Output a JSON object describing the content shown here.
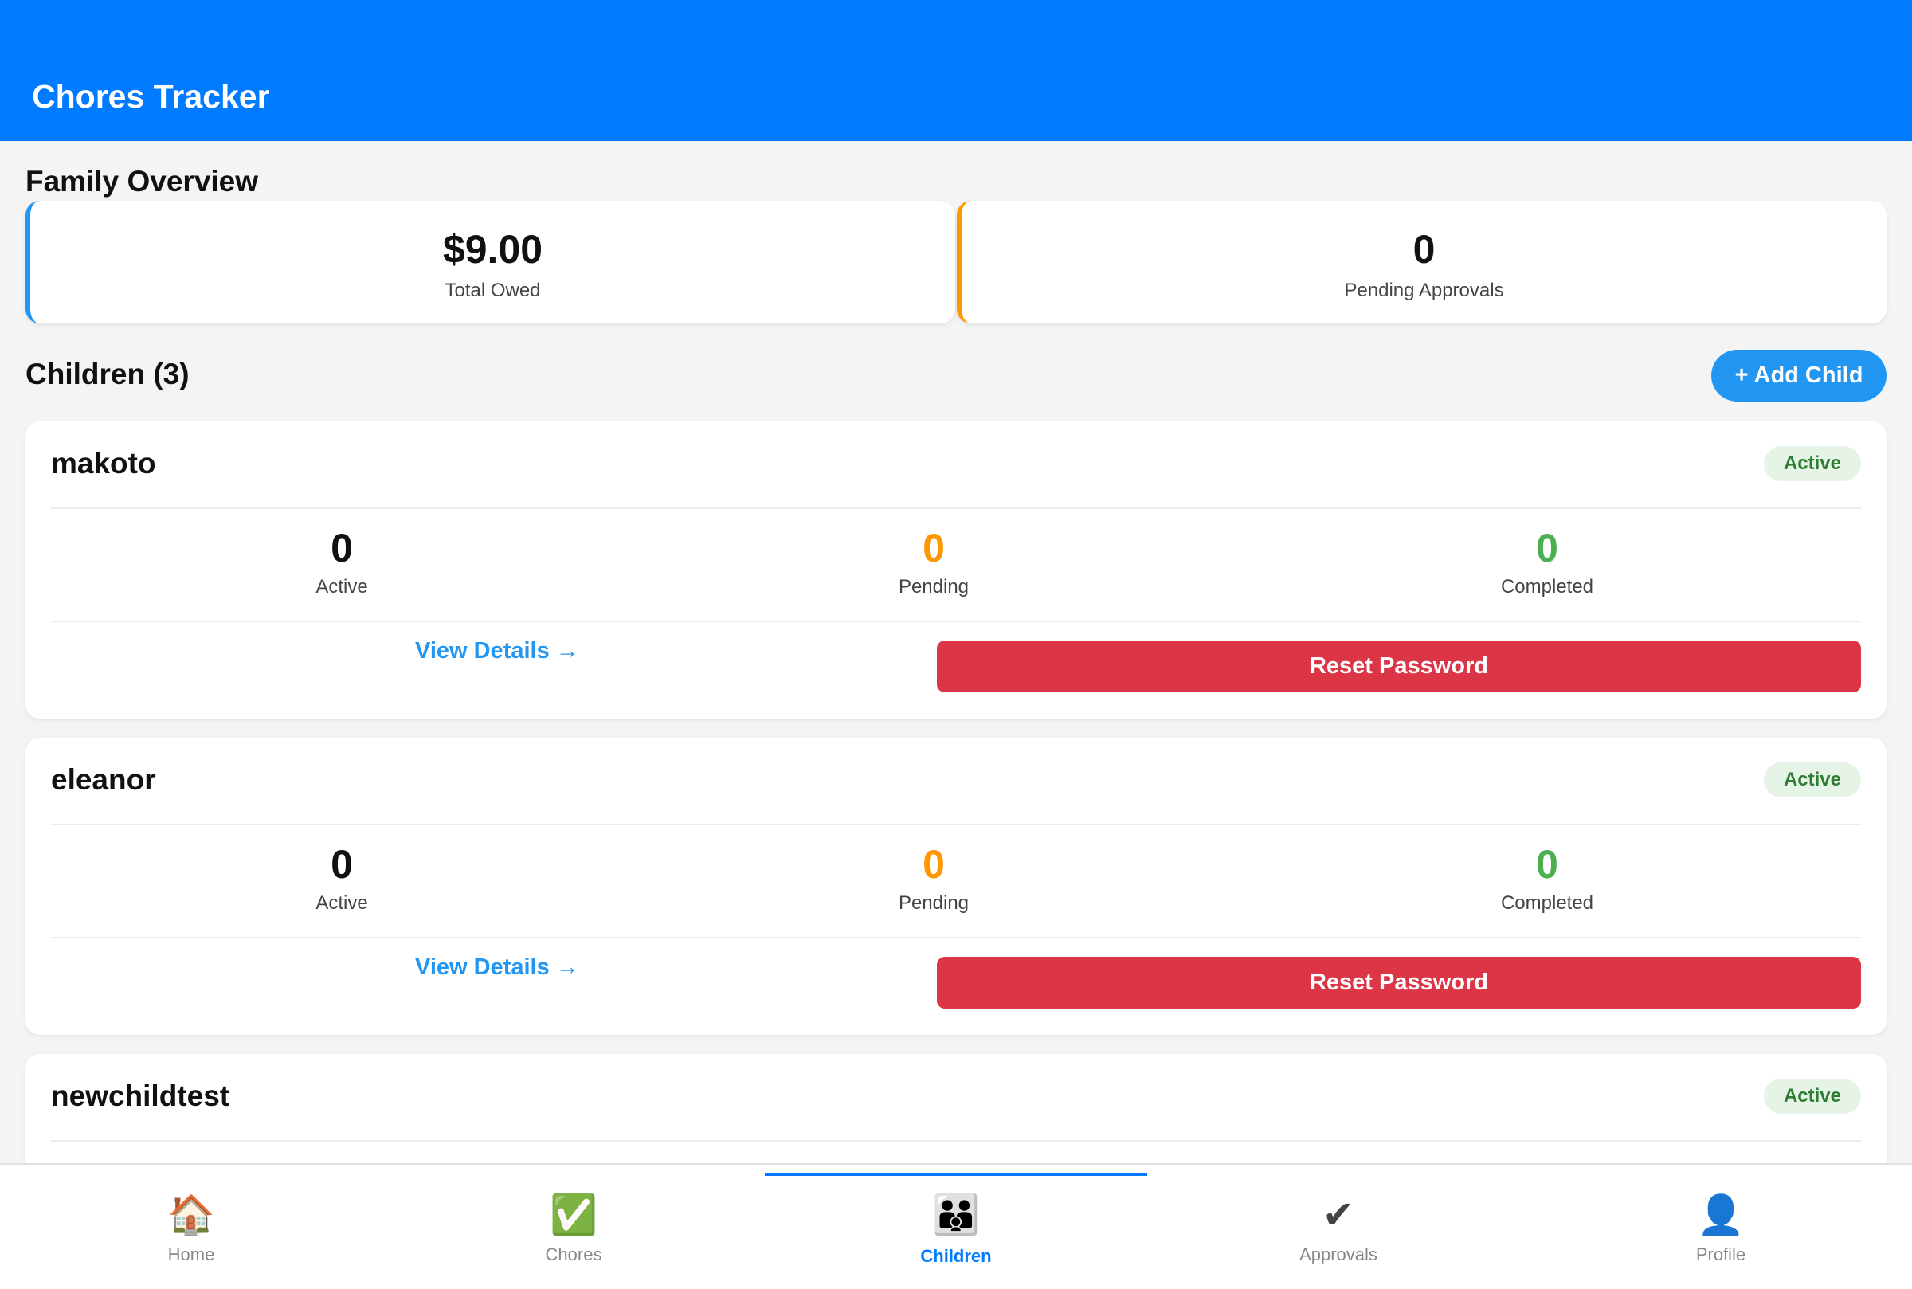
{
  "header": {
    "title": "Chores Tracker"
  },
  "overview": {
    "title": "Family Overview",
    "total_owed": {
      "value": "$9.00",
      "label": "Total Owed",
      "accent": "#2196f3"
    },
    "pending_approvals": {
      "value": "0",
      "label": "Pending Approvals",
      "accent": "#ff9800"
    }
  },
  "children_section": {
    "title": "Children (3)",
    "add_label": "+ Add Child"
  },
  "children": [
    {
      "name": "makoto",
      "status": "Active",
      "active": "0",
      "active_label": "Active",
      "pending": "0",
      "pending_label": "Pending",
      "completed": "0",
      "completed_label": "Completed",
      "view_label": "View Details →",
      "reset_label": "Reset Password"
    },
    {
      "name": "eleanor",
      "status": "Active",
      "active": "0",
      "active_label": "Active",
      "pending": "0",
      "pending_label": "Pending",
      "completed": "0",
      "completed_label": "Completed",
      "view_label": "View Details →",
      "reset_label": "Reset Password"
    },
    {
      "name": "newchildtest",
      "status": "Active"
    }
  ],
  "tabs": [
    {
      "label": "Home",
      "icon": "house-icon",
      "glyph": "🏠"
    },
    {
      "label": "Chores",
      "icon": "check-box-icon",
      "glyph": "✅"
    },
    {
      "label": "Children",
      "icon": "children-icon",
      "glyph": "👪",
      "active": true
    },
    {
      "label": "Approvals",
      "icon": "checkmark-icon",
      "glyph": "✔"
    },
    {
      "label": "Profile",
      "icon": "profile-icon",
      "glyph": "👤"
    }
  ],
  "colors": {
    "primary": "#007aff",
    "link": "#2196f3",
    "pending": "#ff9800",
    "completed": "#4caf50",
    "danger": "#dc3545",
    "badge_bg": "#e6f4e7",
    "badge_text": "#2e7d32"
  }
}
